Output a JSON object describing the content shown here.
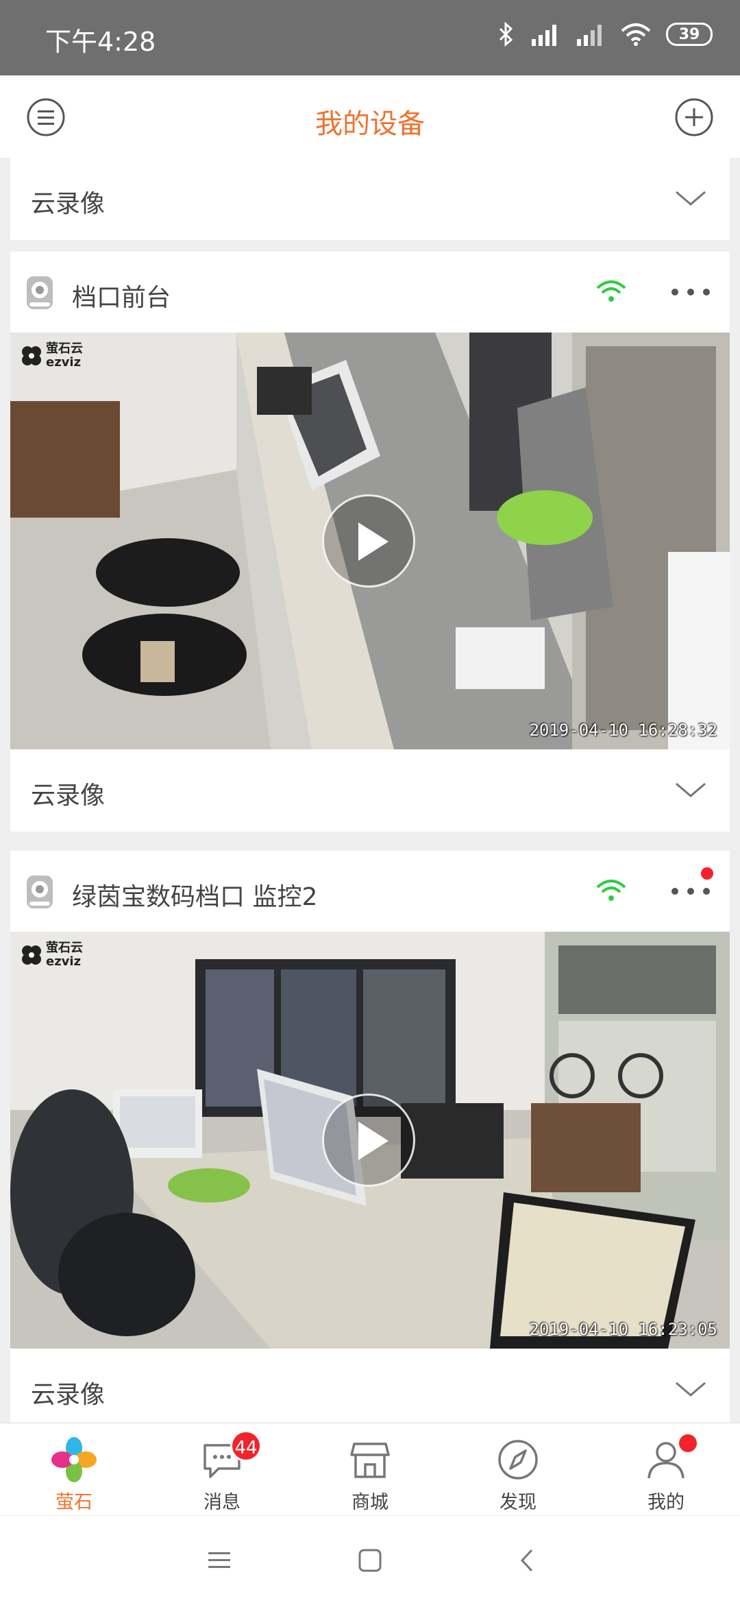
{
  "status_bar": {
    "time": "下午4:28",
    "battery": "39"
  },
  "header": {
    "title": "我的设备"
  },
  "cards": [
    {
      "cloud_label": "云录像"
    },
    {
      "device_name": "档口前台",
      "logo_text_cn": "萤石云",
      "logo_text_en": "ezviz",
      "timestamp": "2019-04-10 16:28:32",
      "cloud_label": "云录像"
    },
    {
      "device_name": "绿茵宝数码档口 监控2",
      "logo_text_cn": "萤石云",
      "logo_text_en": "ezviz",
      "timestamp": "2019-04-10 16:23:05",
      "cloud_label": "云录像"
    }
  ],
  "tabs": [
    {
      "label": "萤石",
      "icon": "ezviz-flower-icon",
      "active": true
    },
    {
      "label": "消息",
      "icon": "chat-icon",
      "badge": "44"
    },
    {
      "label": "商城",
      "icon": "store-icon"
    },
    {
      "label": "发现",
      "icon": "compass-icon"
    },
    {
      "label": "我的",
      "icon": "person-icon",
      "dot": true
    }
  ],
  "colors": {
    "accent": "#f0722d",
    "wifi": "#2ecc40",
    "badge": "#f2232a"
  }
}
